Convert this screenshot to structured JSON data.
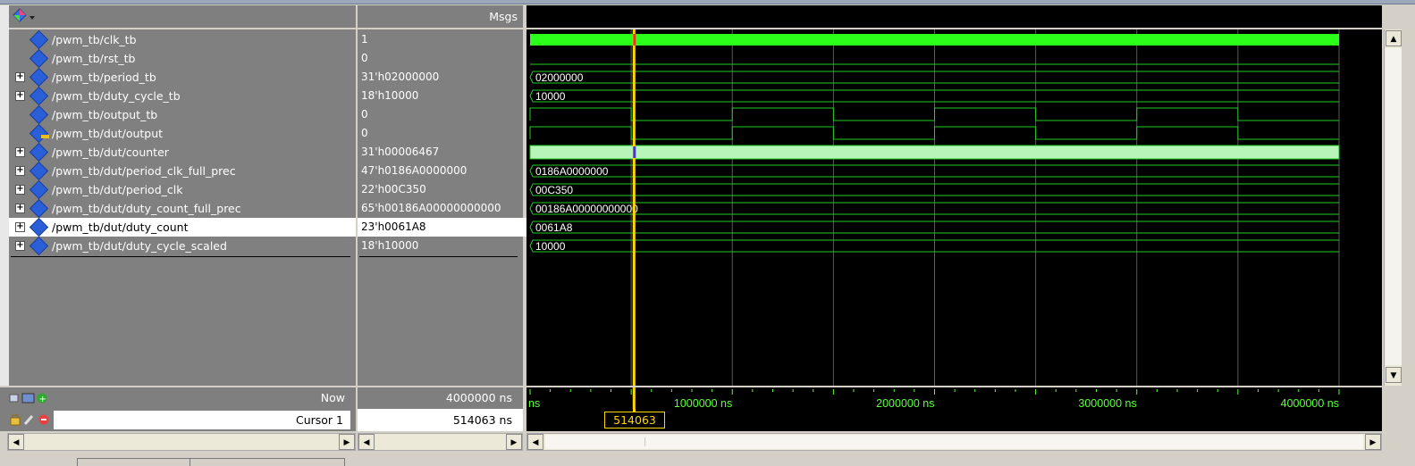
{
  "header": {
    "msgs_label": "Msgs"
  },
  "signals": [
    {
      "name": "/pwm_tb/clk_tb",
      "value": "1",
      "expandable": false,
      "icon": "input-diamond-icon"
    },
    {
      "name": "/pwm_tb/rst_tb",
      "value": "0",
      "expandable": false,
      "icon": "input-diamond-icon"
    },
    {
      "name": "/pwm_tb/period_tb",
      "value": "31'h02000000",
      "expandable": true,
      "icon": "input-diamond-icon"
    },
    {
      "name": "/pwm_tb/duty_cycle_tb",
      "value": "18'h10000",
      "expandable": true,
      "icon": "input-diamond-icon"
    },
    {
      "name": "/pwm_tb/output_tb",
      "value": "0",
      "expandable": false,
      "icon": "input-diamond-icon"
    },
    {
      "name": "/pwm_tb/dut/output",
      "value": "0",
      "expandable": false,
      "icon": "output-diamond-icon"
    },
    {
      "name": "/pwm_tb/dut/counter",
      "value": "31'h00006467",
      "expandable": true,
      "icon": "input-diamond-icon"
    },
    {
      "name": "/pwm_tb/dut/period_clk_full_prec",
      "value": "47'h0186A0000000",
      "expandable": true,
      "icon": "input-diamond-icon"
    },
    {
      "name": "/pwm_tb/dut/period_clk",
      "value": "22'h00C350",
      "expandable": true,
      "icon": "input-diamond-icon"
    },
    {
      "name": "/pwm_tb/dut/duty_count_full_prec",
      "value": "65'h00186A00000000000",
      "expandable": true,
      "icon": "input-diamond-icon"
    },
    {
      "name": "/pwm_tb/dut/duty_count",
      "value": "23'h0061A8",
      "expandable": true,
      "icon": "input-diamond-icon",
      "selected": true
    },
    {
      "name": "/pwm_tb/dut/duty_cycle_scaled",
      "value": "18'h10000",
      "expandable": true,
      "icon": "input-diamond-icon"
    }
  ],
  "bus_values": [
    "02000000",
    "10000",
    "0186A0000000",
    "00C350",
    "00186A00000000000",
    "0061A8",
    "10000"
  ],
  "status": {
    "now_label": "Now",
    "now_value": "4000000 ns",
    "cursor_label": "Cursor 1",
    "cursor_value": "514063 ns",
    "cursor_flag": "514063 ns"
  },
  "timeline": {
    "left_fragment": "ns",
    "ticks": [
      "1000000 ns",
      "2000000 ns",
      "3000000 ns",
      "4000000 ns"
    ]
  },
  "colors": {
    "wave_green": "#2bff1a",
    "cursor_yellow": "#ffd700",
    "bus_green": "#22cc22",
    "counter_fill": "#b8f5b8",
    "diamond_blue": "#2a5fd8"
  }
}
